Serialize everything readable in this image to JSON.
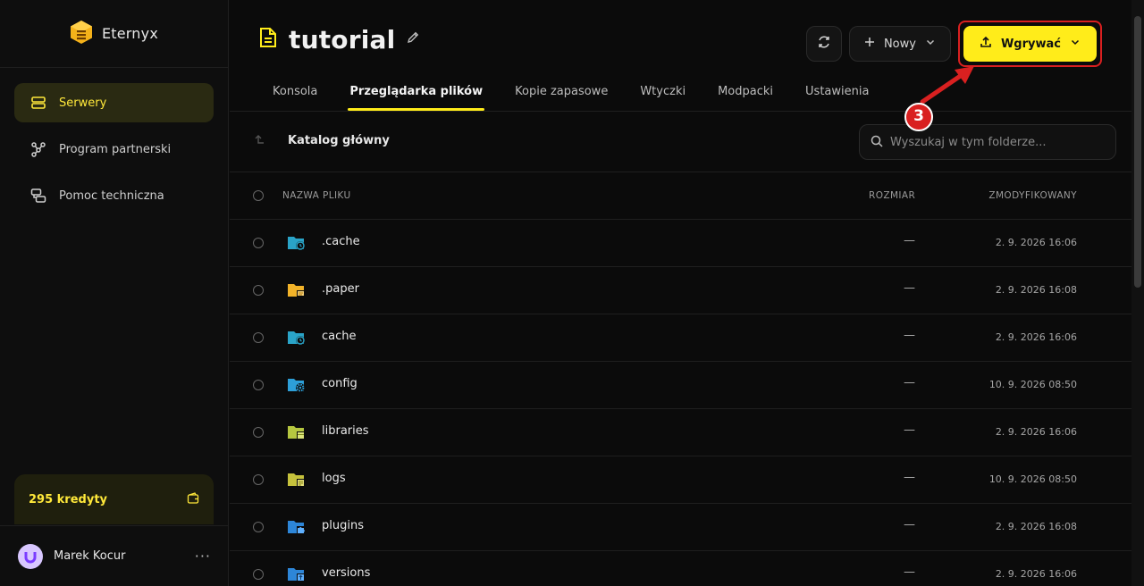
{
  "brand": {
    "name": "Eternyx"
  },
  "sidebar": {
    "items": [
      {
        "label": "Serwery",
        "icon": "server-icon",
        "active": true
      },
      {
        "label": "Program partnerski",
        "icon": "affiliate-icon",
        "active": false
      },
      {
        "label": "Pomoc techniczna",
        "icon": "support-chat-icon",
        "active": false
      }
    ],
    "credits": "295 kredyty",
    "user": "Marek Kocur"
  },
  "header": {
    "title": "tutorial",
    "new_label": "Nowy",
    "upload_label": "Wgrywać"
  },
  "tabs": [
    {
      "label": "Konsola",
      "active": false
    },
    {
      "label": "Przeglądarka plików",
      "active": true
    },
    {
      "label": "Kopie zapasowe",
      "active": false
    },
    {
      "label": "Wtyczki",
      "active": false
    },
    {
      "label": "Modpacki",
      "active": false
    },
    {
      "label": "Ustawienia",
      "active": false
    }
  ],
  "browser": {
    "breadcrumb": "Katalog główny",
    "search_placeholder": "Wyszukaj w tym folderze...",
    "columns": {
      "name": "NAZWA PLIKU",
      "size": "ROZMIAR",
      "modified": "ZMODYFIKOWANY"
    },
    "files": [
      {
        "name": ".cache",
        "size": "—",
        "modified": "2. 9. 2026 16:06",
        "icon": "folder-clock-icon",
        "color": "#2aa4c8"
      },
      {
        "name": ".paper",
        "size": "—",
        "modified": "2. 9. 2026 16:08",
        "icon": "folder-paper-icon",
        "color": "#f2b329"
      },
      {
        "name": "cache",
        "size": "—",
        "modified": "2. 9. 2026 16:06",
        "icon": "folder-clock-icon",
        "color": "#2aa4c8"
      },
      {
        "name": "config",
        "size": "—",
        "modified": "10. 9. 2026 08:50",
        "icon": "folder-gear-icon",
        "color": "#2d9fd8"
      },
      {
        "name": "libraries",
        "size": "—",
        "modified": "2. 9. 2026 16:06",
        "icon": "folder-box-icon",
        "color": "#b6c740"
      },
      {
        "name": "logs",
        "size": "—",
        "modified": "10. 9. 2026 08:50",
        "icon": "folder-log-icon",
        "color": "#c6c23c"
      },
      {
        "name": "plugins",
        "size": "—",
        "modified": "2. 9. 2026 16:08",
        "icon": "folder-puzzle-icon",
        "color": "#2d86d8"
      },
      {
        "name": "versions",
        "size": "—",
        "modified": "2. 9. 2026 16:06",
        "icon": "folder-upload-icon",
        "color": "#2d86d8"
      }
    ]
  },
  "annotation": {
    "step": "3",
    "color": "#d92020"
  },
  "colors": {
    "accent": "#ffec1a",
    "background": "#0b0b0b"
  }
}
